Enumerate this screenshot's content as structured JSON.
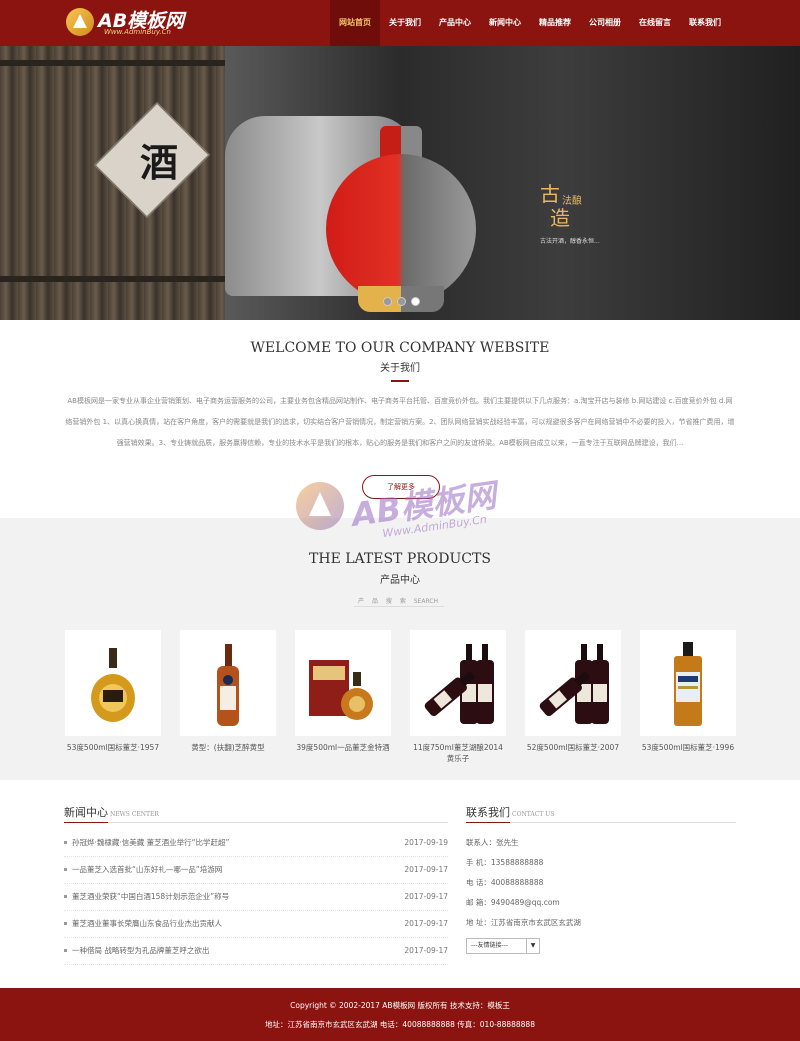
{
  "header": {
    "logo_text": "AB模板网",
    "logo_sub": "Www.AdminBuy.Cn",
    "nav": [
      "网站首页",
      "关于我们",
      "产品中心",
      "新闻中心",
      "精品推荐",
      "公司相册",
      "在线留言",
      "联系我们"
    ],
    "active_nav": "网站首页"
  },
  "banner": {
    "sign_char": "酒",
    "char_gu": "古",
    "char_fa": "法酿",
    "char_zao": "造",
    "tagline": "古法开酒，醇香永恒..."
  },
  "about": {
    "title": "WELCOME TO OUR COMPANY WEBSITE",
    "subtitle": "关于我们",
    "text": "AB模板网是一家专业从事企业营销策划、电子商务运营服务的公司，主要业务包含精品网站制作、电子商务平台托管、百度竞价外包。我们主要提供以下几点服务：a.淘宝开店与装修 b.网站建设 c.百度竞价外包 d.网络营销外包 1、以真心换真情，站在客户角度，客户的需要就是我们的追求，切实结合客户营销情况，制定营销方案。2、团队网络营销实战经验丰富，可以规避很多客户在网络营销中不必要的投入，节省推广费用，增强营销效果。3、专业铸就品质，服务赢得信赖，专业的技术水平是我们的根本，贴心的服务是我们和客户之间的友谊桥梁。AB模板网自成立以来，一直专注于互联网品牌建设，我们...",
    "more_button": "了解更多"
  },
  "products": {
    "title": "THE LATEST PRODUCTS",
    "subtitle": "产品中心",
    "search_labels": [
      "产",
      "品",
      "搜",
      "索",
      "SEARCH"
    ],
    "watermark_text": "AB模板网",
    "watermark_sub": "Www.AdminBuy.Cn",
    "items": [
      {
        "name": "53度500ml国标董芝·1957"
      },
      {
        "name": "黄型：(扶翻)芝醉黄型"
      },
      {
        "name": "39度500ml一品董芝金特酒"
      },
      {
        "name": "11度750ml董芝湖酿2014黄乐子"
      },
      {
        "name": "52度500ml国标董芝·2007"
      },
      {
        "name": "53度500ml国标董芝·1996"
      }
    ]
  },
  "news": {
    "title": "新闻中心",
    "title_en": "NEWS CENTER",
    "items": [
      {
        "title": "孙冠烨·魏棣藏·信美藏 董芝酒业举行“比学赶超”",
        "date": "2017-09-19"
      },
      {
        "title": "一品董芝入选首批“山东好礼—哪一品”培游网",
        "date": "2017-09-17"
      },
      {
        "title": "董芝酒业荣获“中国白酒158计划示范企业”称号",
        "date": "2017-09-17"
      },
      {
        "title": "董芝酒业董事长荣膺山东食品行业杰出贡献人",
        "date": "2017-09-17"
      },
      {
        "title": "一种借局 战略转型为孔品牌董芝呼之欲出",
        "date": "2017-09-17"
      }
    ]
  },
  "contact": {
    "title": "联系我们",
    "title_en": "CONTACT US",
    "rows": [
      "联系人：张先生",
      "手 机：13588888888",
      "电 话：40088888888",
      "邮 箱：9490489@qq.com",
      "地 址：江苏省南京市玄武区玄武湖"
    ],
    "friend_link_select": "---友情链接---"
  },
  "footer": {
    "line1": "Copyright © 2002-2017 AB模板网 版权所有 技术支持：模板王",
    "line2": "地址：江苏省南京市玄武区玄武湖 电话：40088888888 传真：010-88888888"
  },
  "colors": {
    "brand": "#8b1410",
    "accent": "#f3c66a"
  }
}
